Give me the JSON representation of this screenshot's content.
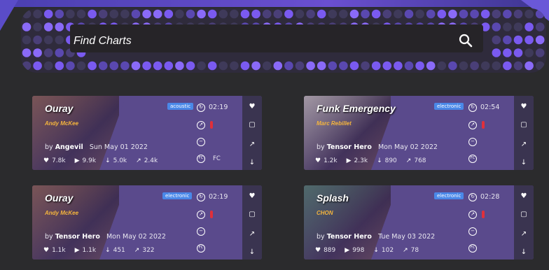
{
  "search": {
    "placeholder": "Find Charts"
  },
  "cards": [
    {
      "title": "Ouray",
      "artist": "Andy McKee",
      "genre": "acoustic",
      "by": "by",
      "charter": "Angevil",
      "date": "Sun May 01 2022",
      "likes": "7.8k",
      "plays": "9.9k",
      "downloads": "5.0k",
      "shares": "2.4k",
      "duration": "02:19",
      "fc": "FC",
      "art_color": "#8a5a3a"
    },
    {
      "title": "Funk Emergency",
      "artist": "Marc Rebillet",
      "genre": "electronic",
      "by": "by",
      "charter": "Tensor Hero",
      "date": "Mon May 02 2022",
      "likes": "1.2k",
      "plays": "2.3k",
      "downloads": "890",
      "shares": "768",
      "duration": "02:54",
      "fc": "",
      "art_color": "#c8c0b0"
    },
    {
      "title": "Ouray",
      "artist": "Andy McKee",
      "genre": "electronic",
      "by": "by",
      "charter": "Tensor Hero",
      "date": "Mon May 02 2022",
      "likes": "1.1k",
      "plays": "1.1k",
      "downloads": "451",
      "shares": "322",
      "duration": "02:19",
      "fc": "",
      "art_color": "#8a5a3a"
    },
    {
      "title": "Splash",
      "artist": "CHON",
      "genre": "electronic",
      "by": "by",
      "charter": "Tensor Hero",
      "date": "Tue May 03 2022",
      "likes": "889",
      "plays": "998",
      "downloads": "102",
      "shares": "78",
      "duration": "02:28",
      "fc": "",
      "art_color": "#4a7a5a"
    }
  ],
  "colors": {
    "accent": "#7a5af0",
    "card_bg": "#5a4a8c",
    "genre_badge": "#4a88e8",
    "artist": "#f5b53d",
    "difficulty": "#e0303a"
  },
  "icons": [
    "search-icon",
    "clock-icon",
    "difficulty-icon",
    "speedometer-icon",
    "fc-icon",
    "heart-icon",
    "twitch-icon",
    "share-icon",
    "download-icon",
    "play-icon"
  ]
}
